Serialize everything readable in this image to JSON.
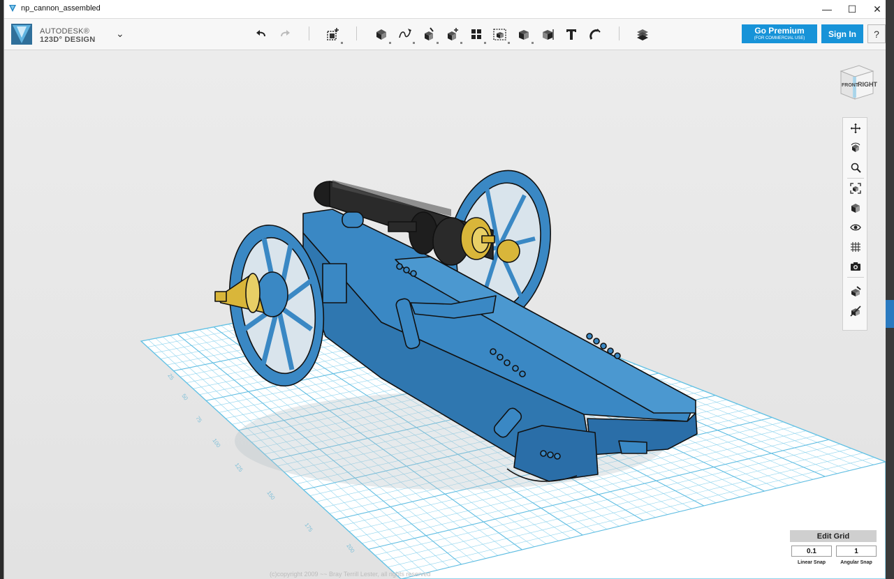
{
  "window": {
    "title": "np_cannon_assembled",
    "controls": {
      "minimize": "—",
      "maximize": "☐",
      "close": "✕"
    }
  },
  "brand": {
    "line1": "AUTODESK®",
    "line2": "123D° DESIGN",
    "menu_icon": "chevron-down-icon"
  },
  "toolbar": {
    "tools": [
      {
        "name": "undo-icon"
      },
      {
        "name": "redo-icon"
      },
      {
        "name": "transform-icon"
      },
      {
        "name": "primitives-icon"
      },
      {
        "name": "sketch-icon"
      },
      {
        "name": "construct-icon"
      },
      {
        "name": "modify-icon"
      },
      {
        "name": "pattern-icon"
      },
      {
        "name": "grouping-icon"
      },
      {
        "name": "combine-icon"
      },
      {
        "name": "measure-icon"
      },
      {
        "name": "text-icon"
      },
      {
        "name": "snap-icon"
      },
      {
        "name": "material-icon"
      }
    ],
    "premium_label": "Go Premium",
    "premium_sub": "(FOR COMMERCIAL USE)",
    "signin_label": "Sign In",
    "help_label": "?"
  },
  "viewcube": {
    "front": "FRONT",
    "right": "RIGHT"
  },
  "navbar": {
    "items": [
      "pan-icon",
      "orbit-icon",
      "zoom-icon",
      "fit-icon",
      "views-icon",
      "visibility-icon",
      "grid-icon",
      "camera-icon",
      "material-visibility-icon",
      "hide-icon"
    ]
  },
  "grid": {
    "labels": [
      "25",
      "50",
      "75",
      "100",
      "125",
      "150",
      "175",
      "200"
    ]
  },
  "snap": {
    "edit_grid_label": "Edit Grid",
    "linear_value": "0.1",
    "angular_value": "1",
    "linear_label": "Linear Snap",
    "angular_label": "Angular Snap"
  },
  "copyright": "(c)copyright 2009 ~~ Bray Terrill Lester, all rights reserved",
  "colors": {
    "accent": "#1793d8",
    "model_blue": "#3a88c4",
    "barrel": "#1e1e1e",
    "brass": "#d9b63a",
    "grid": "#6cc6e6"
  }
}
